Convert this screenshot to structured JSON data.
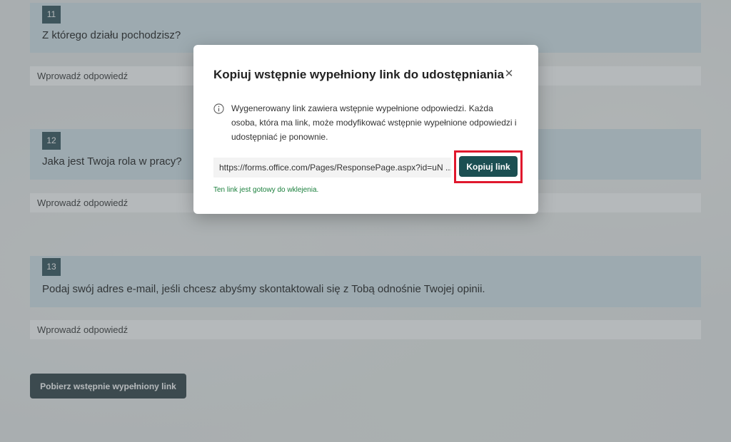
{
  "questions": [
    {
      "number": "11",
      "text": "Z którego działu pochodzisz?",
      "answer_placeholder": "Wprowadź odpowiedź"
    },
    {
      "number": "12",
      "text": "Jaka jest Twoja rola w pracy?",
      "answer_placeholder": "Wprowadź odpowiedź"
    },
    {
      "number": "13",
      "text": "Podaj swój adres e-mail, jeśli chcesz abyśmy skontaktowali się z Tobą odnośnie Twojej opinii.",
      "answer_placeholder": "Wprowadź odpowiedź"
    }
  ],
  "get_link_button": "Pobierz wstępnie wypełniony link",
  "dialog": {
    "title": "Kopiuj wstępnie wypełniony link do udostępniania",
    "close_icon": "close-icon",
    "info_icon": "info-icon",
    "info_text": "Wygenerowany link zawiera wstępnie wypełnione odpowiedzi. Każda osoba, która ma link, może modyfikować wstępnie wypełnione odpowiedzi i udostępniać je ponownie.",
    "link_value": "https://forms.office.com/Pages/ResponsePage.aspx?id=uN ...",
    "copy_button": "Kopiuj link",
    "ready_text": "Ten link jest gotowy do wklejenia."
  },
  "colors": {
    "question_bg": "#d9e7ed",
    "number_badge": "#3f5e66",
    "copy_button": "#1b4f52",
    "highlight": "#e0182d",
    "ready_text": "#1a7f3c"
  }
}
